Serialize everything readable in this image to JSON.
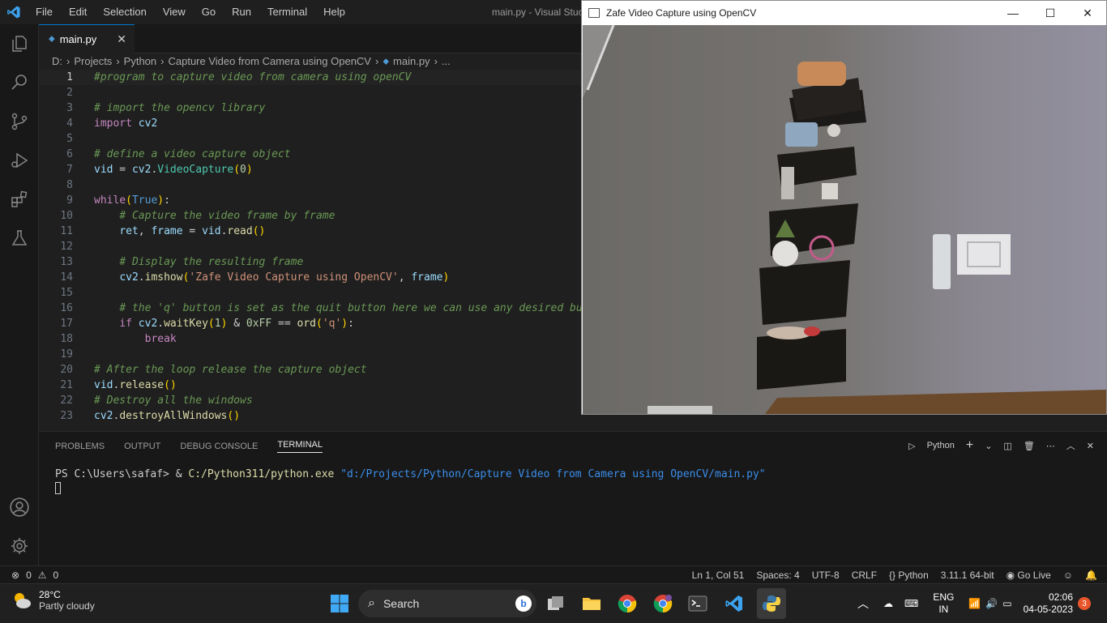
{
  "menu": [
    "File",
    "Edit",
    "Selection",
    "View",
    "Go",
    "Run",
    "Terminal",
    "Help"
  ],
  "window_title": "main.py - Visual Studio Code",
  "window_title_visible": "main.py - Visual Stuc",
  "tab": {
    "label": "main.py",
    "close": "✕"
  },
  "breadcrumb": [
    "D:",
    "Projects",
    "Python",
    "Capture Video from Camera using OpenCV",
    "main.py",
    "..."
  ],
  "code": [
    {
      "n": "1",
      "t": "#program to capture video from camera using openCV"
    },
    {
      "n": "2",
      "t": ""
    },
    {
      "n": "3",
      "t": "# import the opencv library"
    },
    {
      "n": "4",
      "t": "import cv2"
    },
    {
      "n": "5",
      "t": ""
    },
    {
      "n": "6",
      "t": "# define a video capture object"
    },
    {
      "n": "7",
      "t": "vid = cv2.VideoCapture(0)"
    },
    {
      "n": "8",
      "t": ""
    },
    {
      "n": "9",
      "t": "while(True):"
    },
    {
      "n": "10",
      "t": "    # Capture the video frame by frame"
    },
    {
      "n": "11",
      "t": "    ret, frame = vid.read()"
    },
    {
      "n": "12",
      "t": ""
    },
    {
      "n": "13",
      "t": "    # Display the resulting frame"
    },
    {
      "n": "14",
      "t": "    cv2.imshow('Zafe Video Capture using OpenCV', frame)"
    },
    {
      "n": "15",
      "t": ""
    },
    {
      "n": "16",
      "t": "    # the 'q' button is set as the quit button here we can use any desired but"
    },
    {
      "n": "17",
      "t": "    if cv2.waitKey(1) & 0xFF == ord('q'):"
    },
    {
      "n": "18",
      "t": "        break"
    },
    {
      "n": "19",
      "t": ""
    },
    {
      "n": "20",
      "t": "# After the loop release the capture object"
    },
    {
      "n": "21",
      "t": "vid.release()"
    },
    {
      "n": "22",
      "t": "# Destroy all the windows"
    },
    {
      "n": "23",
      "t": "cv2.destroyAllWindows()"
    }
  ],
  "panel": {
    "tabs": [
      "PROBLEMS",
      "OUTPUT",
      "DEBUG CONSOLE",
      "TERMINAL"
    ],
    "active_tab": "TERMINAL",
    "shell": "Python",
    "term_prompt": "PS C:\\Users\\safaf> ",
    "term_amp": "& ",
    "term_exe": "C:/Python311/python.exe",
    "term_arg": "\"d:/Projects/Python/Capture Video from Camera using OpenCV/main.py\""
  },
  "status": {
    "errors": "0",
    "warnings": "0",
    "position": "Ln 1, Col 51",
    "spaces": "Spaces: 4",
    "encoding": "UTF-8",
    "eol": "CRLF",
    "language": "Python",
    "interpreter": "3.11.1 64-bit",
    "golive": "Go Live"
  },
  "cv_window": {
    "title": "Zafe Video Capture using OpenCV",
    "min": "—",
    "max": "☐",
    "close": "✕"
  },
  "taskbar": {
    "temp": "28°C",
    "weather": "Partly cloudy",
    "search": "Search",
    "lang1": "ENG",
    "lang2": "IN",
    "time": "02:06",
    "date": "04-05-2023",
    "badge": "3"
  },
  "colors": {
    "accent": "#0078d4",
    "editor_bg": "#1f1f1f",
    "sidebar_bg": "#181818"
  }
}
